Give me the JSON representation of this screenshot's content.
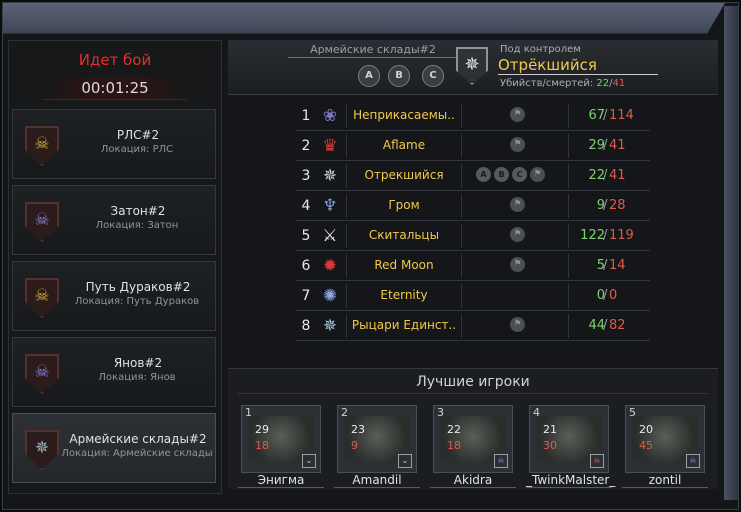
{
  "battle": {
    "title": "Идет бой",
    "timer": "00:01:25"
  },
  "locations": [
    {
      "name": "РЛС#2",
      "location": "Локация: РЛС",
      "icon": "skull-icon",
      "color": "#d6b13a"
    },
    {
      "name": "Затон#2",
      "location": "Локация: Затон",
      "icon": "skull-icon",
      "color": "#8a84d8"
    },
    {
      "name": "Путь Дураков#2",
      "location": "Локация: Путь Дураков",
      "icon": "skull-icon",
      "color": "#d6b13a"
    },
    {
      "name": "Янов#2",
      "location": "Локация: Янов",
      "icon": "skull-icon",
      "color": "#8a84d8"
    },
    {
      "name": "Армейские склады#2",
      "location": "Локация: Армейские склады",
      "icon": "compass-icon",
      "color": "#9fb6c8"
    }
  ],
  "header": {
    "warehouse": "Армейские склады#2",
    "points": [
      "A",
      "B",
      "C"
    ],
    "control_label": "Под контролем",
    "control_name": "Отрёкшийся",
    "kd_label": "Убийств/смертей:",
    "kills": "22",
    "deaths": "41"
  },
  "clans": [
    {
      "rank": "1",
      "name": "Неприкасаемы..",
      "icon": "lotus-icon",
      "color": "#7d74c9",
      "points": [],
      "kills": "67",
      "deaths": "114"
    },
    {
      "rank": "2",
      "name": "Aflame",
      "icon": "demon-icon",
      "color": "#d63a34",
      "points": [],
      "kills": "29",
      "deaths": "41"
    },
    {
      "rank": "3",
      "name": "Отрекшийся",
      "icon": "compass-icon",
      "color": "#cfd6dc",
      "points": [
        "A",
        "B",
        "C"
      ],
      "kills": "22",
      "deaths": "41"
    },
    {
      "rank": "4",
      "name": "Гром",
      "icon": "wings-icon",
      "color": "#7d9fd0",
      "points": [],
      "kills": "9",
      "deaths": "28"
    },
    {
      "rank": "5",
      "name": "Скитальцы",
      "icon": "crossed-swords-icon",
      "color": "#e6e9ec",
      "points": [],
      "kills": "122",
      "deaths": "119"
    },
    {
      "rank": "6",
      "name": "Red Moon",
      "icon": "star-icon",
      "color": "#d63a34",
      "points": [],
      "kills": "5",
      "deaths": "14"
    },
    {
      "rank": "7",
      "name": "Eternity",
      "icon": "spark-icon",
      "color": "#8fa4e0",
      "points": null,
      "kills": "0",
      "deaths": "0"
    },
    {
      "rank": "8",
      "name": "Рыцари Единст..",
      "icon": "compass-icon",
      "color": "#a8c8dc",
      "points": [],
      "kills": "44",
      "deaths": "82"
    }
  ],
  "best": {
    "title": "Лучшие игроки",
    "players": [
      {
        "rank": "1",
        "name": "Энигма",
        "kills": "29",
        "deaths": "18",
        "badge": "chevron-icon"
      },
      {
        "rank": "2",
        "name": "Amandil",
        "kills": "23",
        "deaths": "9",
        "badge": "chevron-icon"
      },
      {
        "rank": "3",
        "name": "Akidra",
        "kills": "22",
        "deaths": "18",
        "badge": "skull-icon"
      },
      {
        "rank": "4",
        "name": "_TwinkMalster_",
        "kills": "21",
        "deaths": "30",
        "badge": "skull-icon"
      },
      {
        "rank": "5",
        "name": "zontil",
        "kills": "20",
        "deaths": "45",
        "badge": "skull-icon"
      }
    ]
  }
}
